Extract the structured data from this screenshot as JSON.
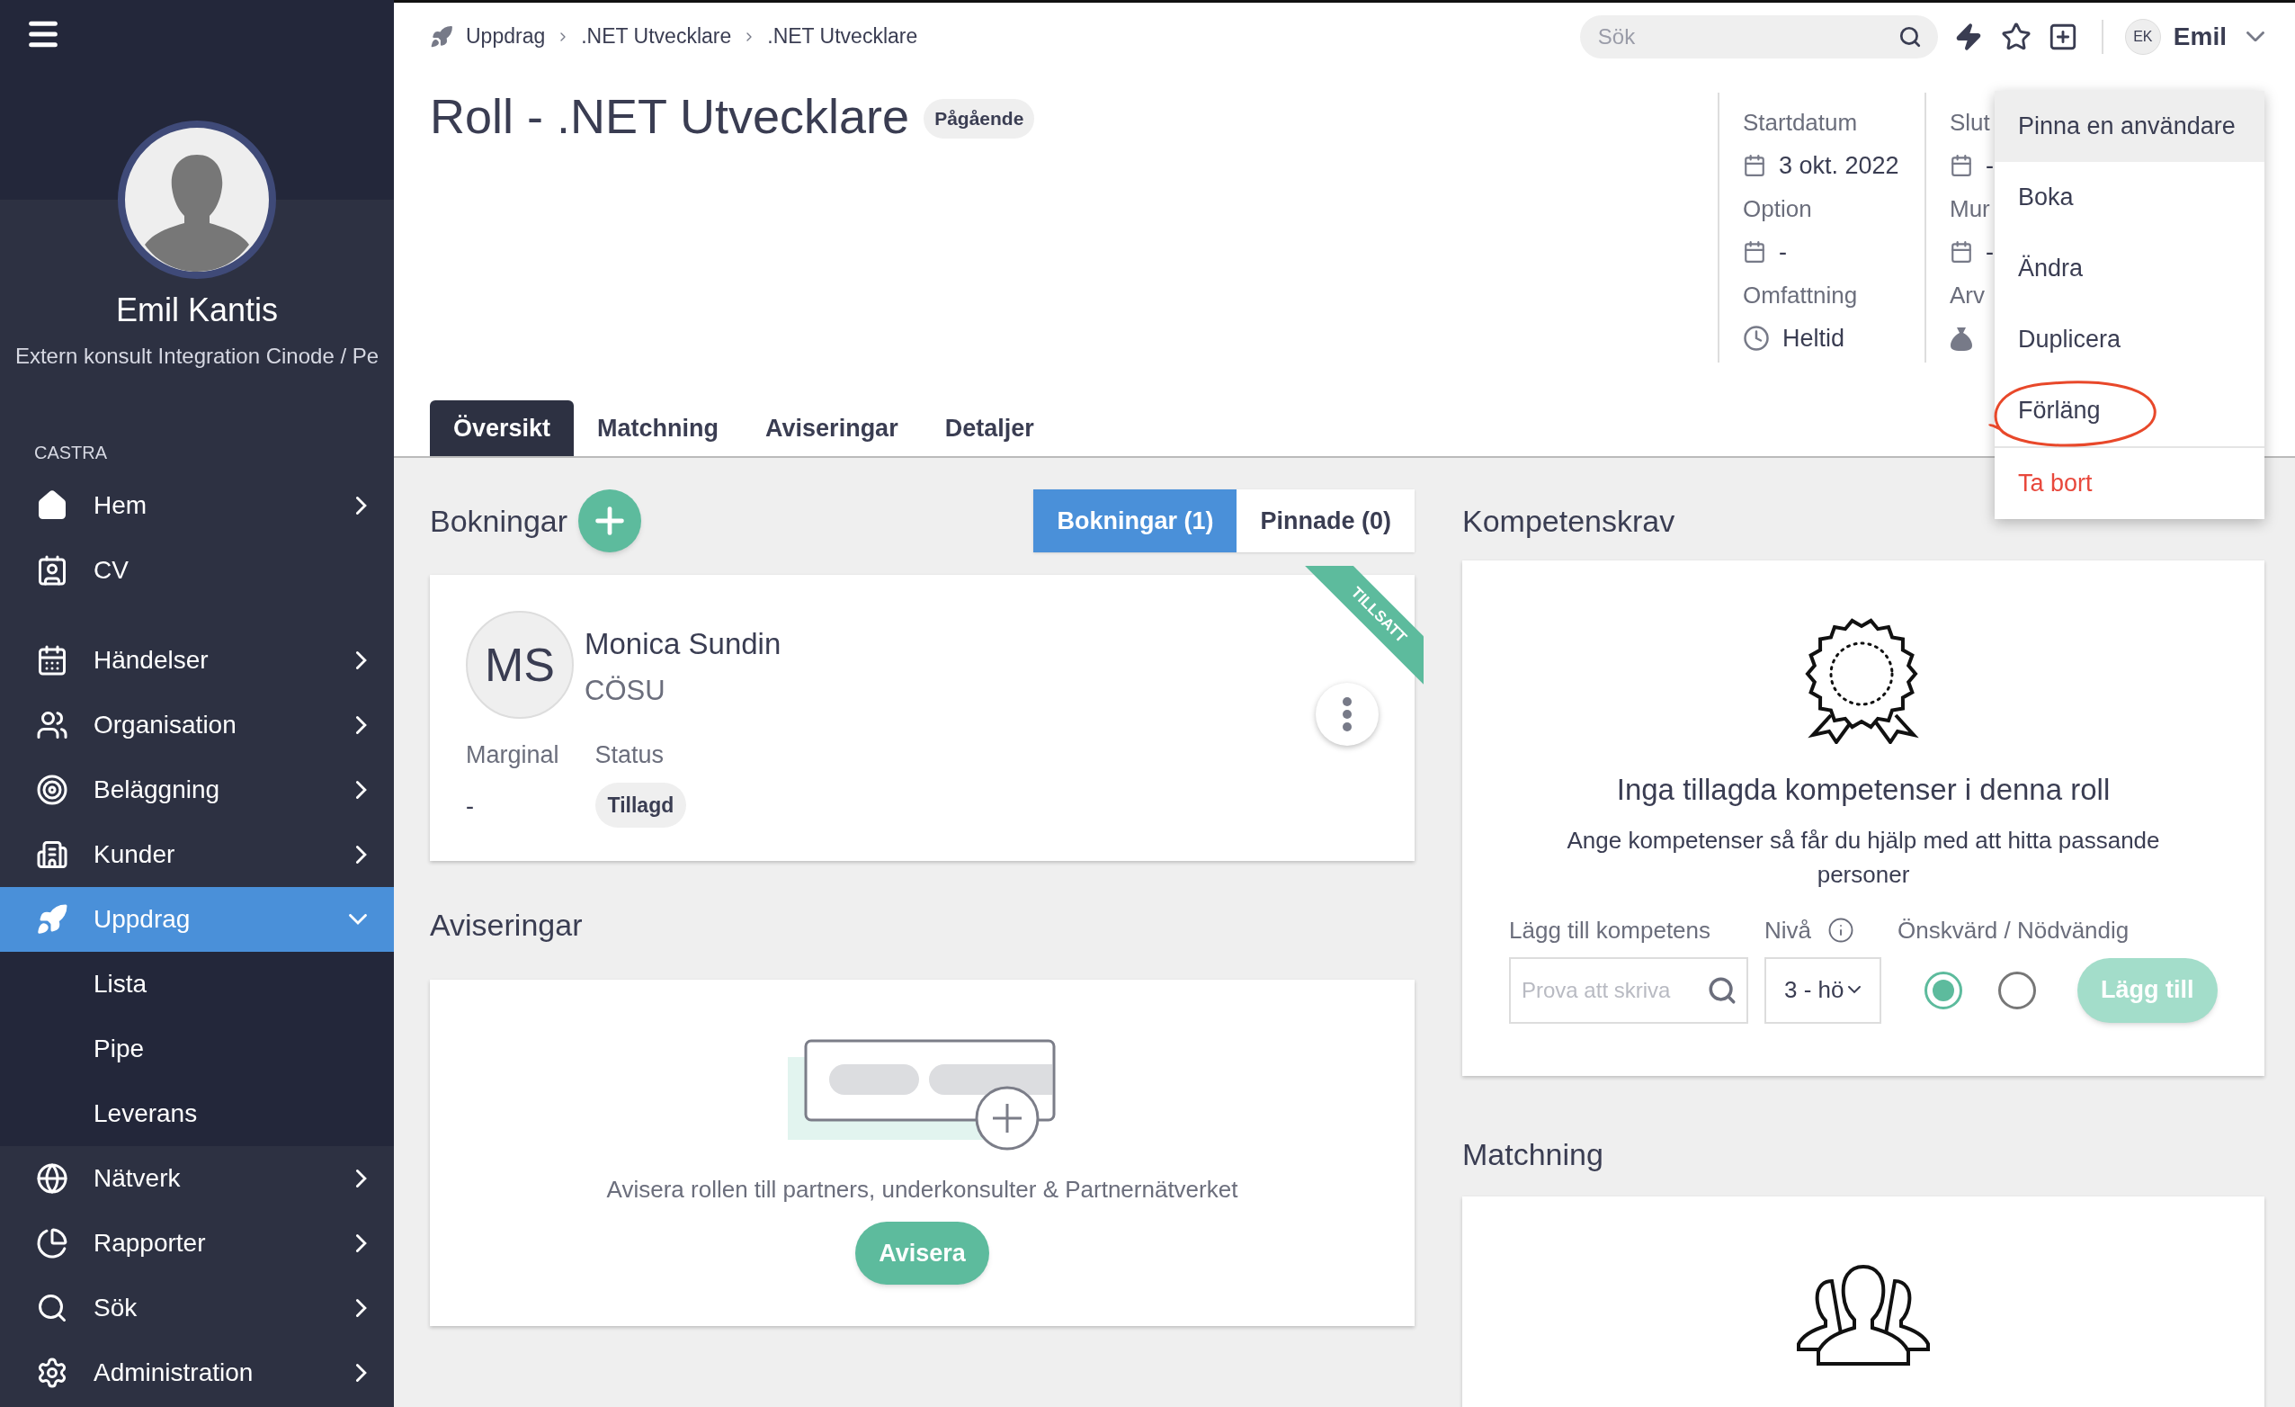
{
  "sidebar": {
    "user": {
      "name": "Emil Kantis",
      "title": "Extern konsult Integration Cinode / Pe"
    },
    "section": "CASTRA",
    "groups": [
      {
        "items": [
          {
            "label": "Hem",
            "expandable": true,
            "expanded": false,
            "selected": false
          },
          {
            "label": "CV",
            "expandable": false,
            "expanded": false,
            "selected": false
          }
        ]
      },
      {
        "items": [
          {
            "label": "Händelser",
            "expandable": true,
            "expanded": false,
            "selected": false
          },
          {
            "label": "Organisation",
            "expandable": true,
            "expanded": false,
            "selected": false
          },
          {
            "label": "Beläggning",
            "expandable": true,
            "expanded": false,
            "selected": false
          },
          {
            "label": "Kunder",
            "expandable": true,
            "expanded": false,
            "selected": false
          },
          {
            "label": "Uppdrag",
            "expandable": true,
            "expanded": true,
            "selected": true,
            "children": [
              {
                "label": "Lista"
              },
              {
                "label": "Pipe"
              },
              {
                "label": "Leverans"
              }
            ]
          },
          {
            "label": "Nätverk",
            "expandable": true,
            "expanded": false,
            "selected": false
          },
          {
            "label": "Rapporter",
            "expandable": true,
            "expanded": false,
            "selected": false
          },
          {
            "label": "Sök",
            "expandable": true,
            "expanded": false,
            "selected": false
          },
          {
            "label": "Administration",
            "expandable": true,
            "expanded": false,
            "selected": false
          }
        ]
      }
    ]
  },
  "topbar": {
    "breadcrumb": [
      "Uppdrag",
      ".NET Utvecklare",
      ".NET Utvecklare"
    ],
    "search": {
      "placeholder": "Sök"
    },
    "user": {
      "initials": "EK",
      "name": "Emil"
    }
  },
  "header": {
    "title": "Roll - .NET Utvecklare",
    "status": "Pågående",
    "columns": [
      {
        "fields": [
          {
            "label": "Startdatum",
            "value": "3 okt. 2022",
            "kind": "date"
          },
          {
            "label": "Option",
            "value": "-",
            "kind": "date"
          },
          {
            "label": "Omfattning",
            "value": "Heltid",
            "kind": "time"
          }
        ]
      },
      {
        "fields": [
          {
            "label": "Slut",
            "value": "-",
            "kind": "date"
          },
          {
            "label": "Mur",
            "value": "-",
            "kind": "date"
          },
          {
            "label": "Arv",
            "kind": "money"
          }
        ]
      }
    ]
  },
  "menu": {
    "items": [
      {
        "label": "Pinna en användare",
        "kind": "normal",
        "highlighted": true,
        "circled": false
      },
      {
        "label": "Boka",
        "kind": "normal",
        "highlighted": false,
        "circled": false
      },
      {
        "label": "Ändra",
        "kind": "normal",
        "highlighted": false,
        "circled": false
      },
      {
        "label": "Duplicera",
        "kind": "normal",
        "highlighted": false,
        "circled": false
      },
      {
        "label": "Förläng",
        "kind": "normal",
        "highlighted": false,
        "circled": true
      },
      {
        "label": "Ta bort",
        "kind": "danger",
        "highlighted": false,
        "circled": false
      }
    ]
  },
  "tabs": [
    {
      "label": "Översikt",
      "selected": true
    },
    {
      "label": "Matchning",
      "selected": false
    },
    {
      "label": "Aviseringar",
      "selected": false
    },
    {
      "label": "Detaljer",
      "selected": false
    }
  ],
  "bookings": {
    "title": "Bokningar",
    "toggles": [
      {
        "label": "Bokningar (1)",
        "selected": true
      },
      {
        "label": "Pinnade (0)",
        "selected": false
      }
    ],
    "card": {
      "initials": "MS",
      "name": "Monica Sundin",
      "company": "CÖSU",
      "ribbon": "TILLSATT",
      "margin_label": "Marginal",
      "margin_value": "-",
      "status_label": "Status",
      "status": "Tillagd"
    }
  },
  "notifications": {
    "title": "Aviseringar",
    "text": "Avisera rollen till partners, underkonsulter & Partnernätverket",
    "button": "Avisera"
  },
  "competence": {
    "title": "Kompetenskrav",
    "empty_title": "Inga tillagda kompetenser i denna roll",
    "empty_text": "Ange kompetenser så får du hjälp med att hitta passande personer",
    "search_label": "Lägg till kompetens",
    "search_placeholder": "Prova att skriva",
    "level_label": "Nivå",
    "level_value": "3 - hö",
    "need_label": "Önskvärd / Nödvändig",
    "options": [
      {
        "selected": true
      },
      {
        "selected": false
      }
    ],
    "button": "Lägg till"
  },
  "matching": {
    "title": "Matchning"
  }
}
